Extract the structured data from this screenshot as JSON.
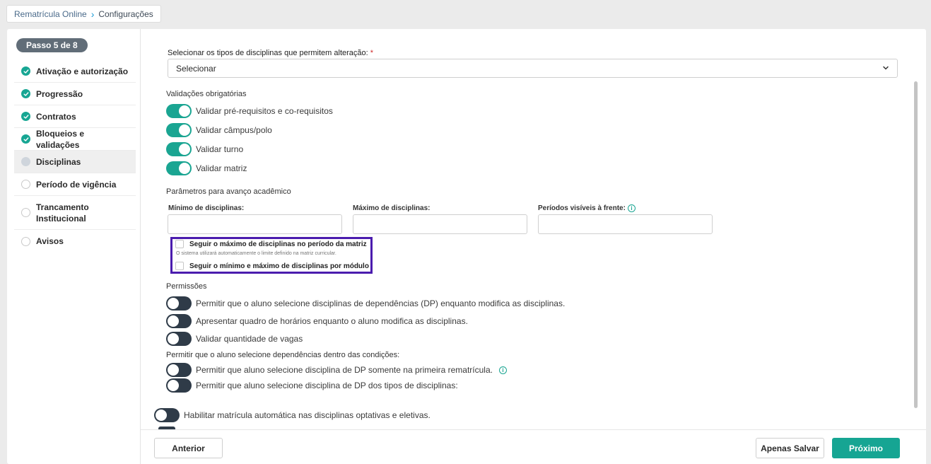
{
  "breadcrumb": {
    "parent": "Rematrícula Online",
    "separator": "›",
    "current": "Configurações"
  },
  "stepper": {
    "badge": "Passo 5 de 8",
    "items": [
      {
        "label": "Ativação e autorização",
        "status": "done"
      },
      {
        "label": "Progressão",
        "status": "done"
      },
      {
        "label": "Contratos",
        "status": "done"
      },
      {
        "label": "Bloqueios e validações",
        "status": "done"
      },
      {
        "label": "Disciplinas",
        "status": "current"
      },
      {
        "label": "Período de vigência",
        "status": "todo"
      },
      {
        "label": "Trancamento Institucional",
        "status": "todo"
      },
      {
        "label": "Avisos",
        "status": "todo"
      }
    ]
  },
  "main": {
    "discipline_types": {
      "label": "Selecionar os tipos de disciplinas que permitem alteração:",
      "required_mark": "*",
      "value": "Selecionar"
    },
    "validations": {
      "title": "Validações obrigatórias",
      "items": [
        {
          "label": "Validar pré-requisitos e co-requisitos",
          "on": true
        },
        {
          "label": "Validar câmpus/polo",
          "on": true
        },
        {
          "label": "Validar turno",
          "on": true
        },
        {
          "label": "Validar matriz",
          "on": true
        }
      ]
    },
    "params": {
      "title": "Parâmetros para avanço acadêmico",
      "min_label": "Mínimo de disciplinas:",
      "max_label": "Máximo de disciplinas:",
      "periods_label": "Períodos visíveis à frente:",
      "min_value": "",
      "max_value": "",
      "periods_value": ""
    },
    "checkboxes": {
      "follow_max": "Seguir o máximo de disciplinas no período da matriz",
      "follow_max_hint": "O sistema utilizará automaticamente o limite definido na matriz curricular.",
      "follow_module": "Seguir o mínimo e máximo de disciplinas por módulo"
    },
    "permissions": {
      "title": "Permissões",
      "items": [
        {
          "label": "Permitir que o aluno selecione disciplinas de dependências (DP) enquanto modifica as disciplinas.",
          "on": false
        },
        {
          "label": "Apresentar quadro de horários enquanto o aluno modifica as disciplinas.",
          "on": false
        },
        {
          "label": "Validar quantidade de vagas",
          "on": false
        }
      ],
      "conditions_title": "Permitir que o aluno selecione dependências dentro das condições:",
      "conditions": [
        {
          "label": "Permitir que aluno selecione disciplina de DP somente na primeira rematrícula.",
          "on": false
        },
        {
          "label": "Permitir que aluno selecione disciplina de DP dos tipos de disciplinas:",
          "on": false
        }
      ]
    },
    "auto_enroll": {
      "label": "Habilitar matrícula automática nas disciplinas optativas e eletivas.",
      "on": false
    }
  },
  "footer": {
    "previous": "Anterior",
    "save_only": "Apenas Salvar",
    "next": "Próximo"
  },
  "colors": {
    "accent": "#16a593",
    "highlight": "#4b1cae",
    "toggle_off": "#2f3b48"
  },
  "icons": {
    "check": "check-icon",
    "info": "info-icon",
    "chevron": "chevron-down-icon"
  }
}
